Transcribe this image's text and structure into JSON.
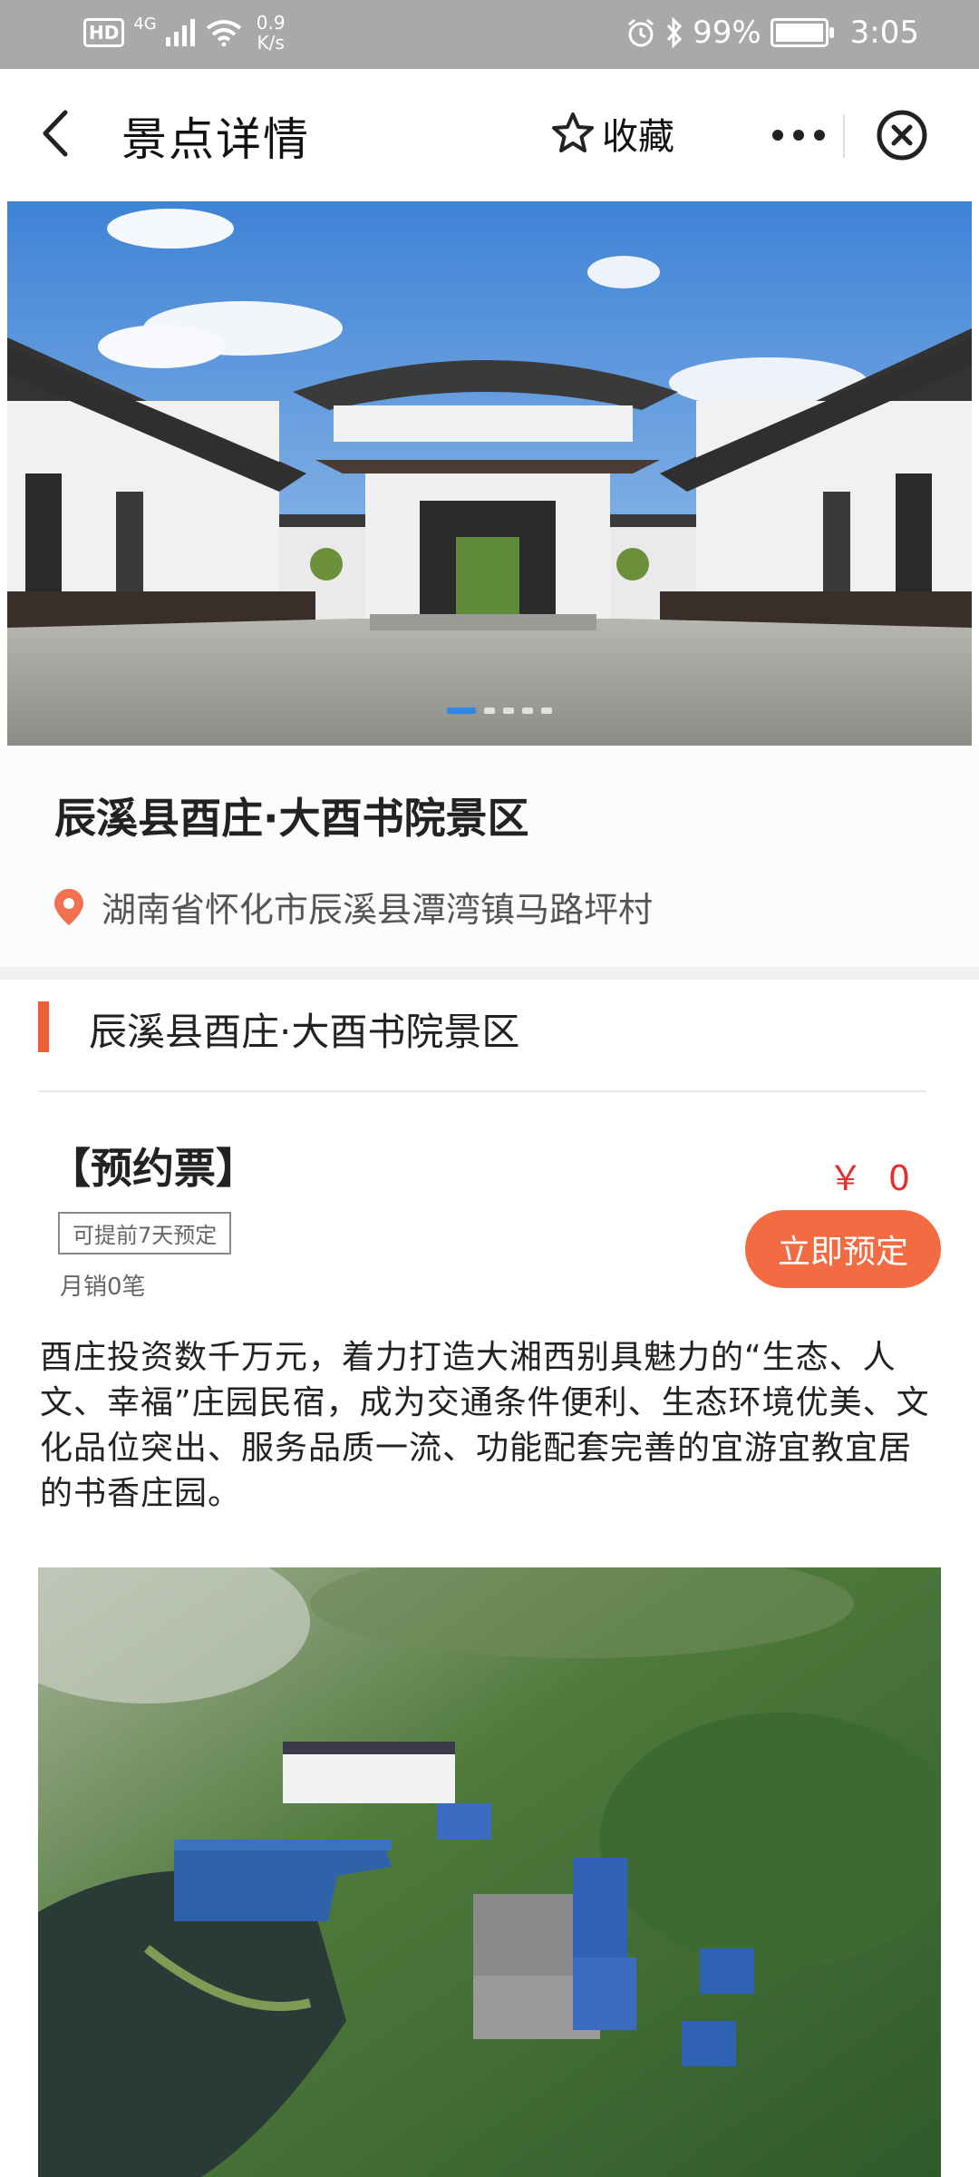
{
  "status_bar": {
    "hd": "HD",
    "network": "4G",
    "speed_value": "0.9",
    "speed_unit": "K/s",
    "battery": "99%",
    "time": "3:05",
    "icons": [
      "signal-icon",
      "wifi-icon",
      "alarm-icon",
      "bluetooth-icon",
      "battery-icon"
    ]
  },
  "nav": {
    "title": "景点详情",
    "favorite_label": "收藏",
    "icons": [
      "back-icon",
      "star-icon",
      "more-icon",
      "close-icon"
    ]
  },
  "carousel": {
    "slide_count": 5,
    "active_index": 0
  },
  "scenic": {
    "title": "辰溪县酉庄·大酉书院景区",
    "address": "湖南省怀化市辰溪县潭湾镇马路坪村"
  },
  "section": {
    "title": "辰溪县酉庄·大酉书院景区"
  },
  "ticket": {
    "name": "【预约票】",
    "advance_tag": "可提前7天预定",
    "monthly_sales": "月销0笔",
    "price": "￥ 0",
    "book_label": "立即预定"
  },
  "description": "酉庄投资数千万元，着力打造大湘西别具魅力的“生态、人文、幸福”庄园民宿，成为交通条件便利、生态环境优美、文化品位突出、服务品质一流、功能配套完善的宜游宜教宜居的书香庄园。",
  "colors": {
    "accent": "#f26b43",
    "price": "#e23030",
    "carousel_active": "#2a8ae4",
    "status_bar": "#a9a9a9"
  }
}
